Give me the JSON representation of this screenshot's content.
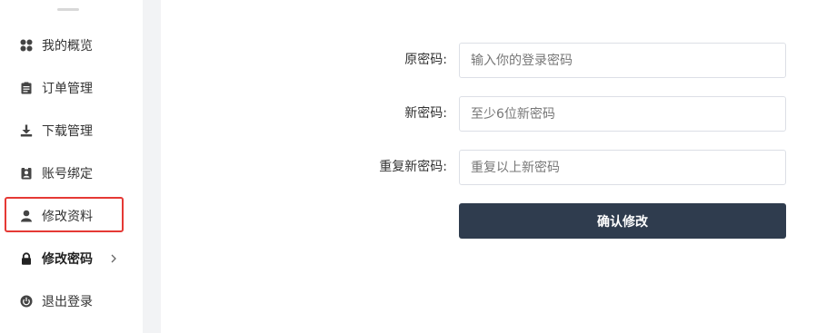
{
  "sidebar": {
    "items": [
      {
        "label": "我的概览",
        "icon": "grid-dots-icon"
      },
      {
        "label": "订单管理",
        "icon": "clipboard-icon"
      },
      {
        "label": "下载管理",
        "icon": "download-icon"
      },
      {
        "label": "账号绑定",
        "icon": "id-badge-icon"
      },
      {
        "label": "修改资料",
        "icon": "user-icon"
      },
      {
        "label": "修改密码",
        "icon": "lock-icon",
        "active": true
      },
      {
        "label": "退出登录",
        "icon": "power-icon"
      }
    ]
  },
  "form": {
    "old_password": {
      "label": "原密码:",
      "placeholder": "输入你的登录密码"
    },
    "new_password": {
      "label": "新密码:",
      "placeholder": "至少6位新密码"
    },
    "confirm_password": {
      "label": "重复新密码:",
      "placeholder": "重复以上新密码"
    },
    "submit_label": "确认修改"
  },
  "colors": {
    "accent": "#2f3c4e",
    "highlight": "#e53935",
    "strip": "#f2f3f5"
  }
}
